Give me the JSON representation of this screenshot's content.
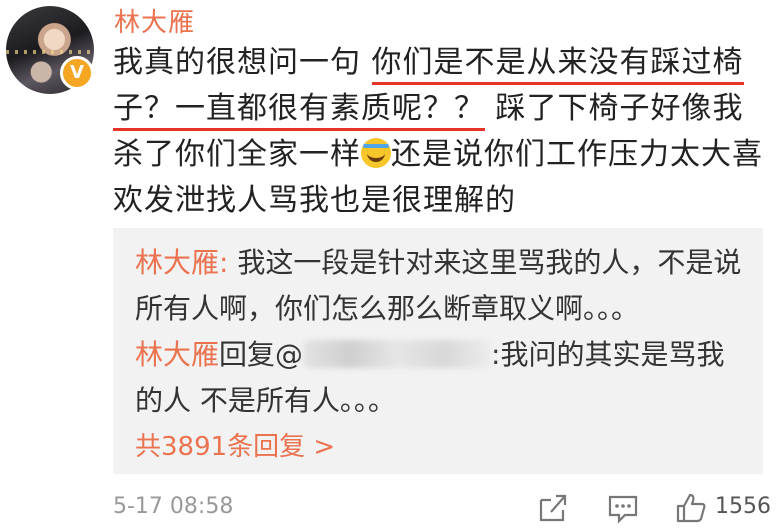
{
  "user": {
    "name": "林大雁",
    "verified_badge": "V"
  },
  "comment": {
    "part1": "我真的很想问一句 ",
    "underlined1": "你们是不是从来没有踩过椅",
    "underlined2": "子？一直都很有素质呢？？",
    "part2": " 踩了下椅子好像我杀了你们全家一样",
    "emoji": "laughing-tears-emoji",
    "part3": "还是说你们工作压力太大喜欢发泄找人骂我也是很理解的"
  },
  "replies": [
    {
      "name": "林大雁",
      "sep": ": ",
      "text": "我这一段是针对来这里骂我的人，不是说所有人啊，你们怎么那么断章取义啊。。。"
    },
    {
      "name": "林大雁",
      "action": "回复@",
      "text": ":我问的其实是骂我的人 不是所有人。。。"
    }
  ],
  "more_replies": "共3891条回复 >",
  "footer": {
    "time": "5-17 08:58",
    "likes": "1556"
  },
  "colors": {
    "accent": "#eb7350",
    "underline": "#e8332b",
    "reply_bg": "#f2f2f2"
  }
}
